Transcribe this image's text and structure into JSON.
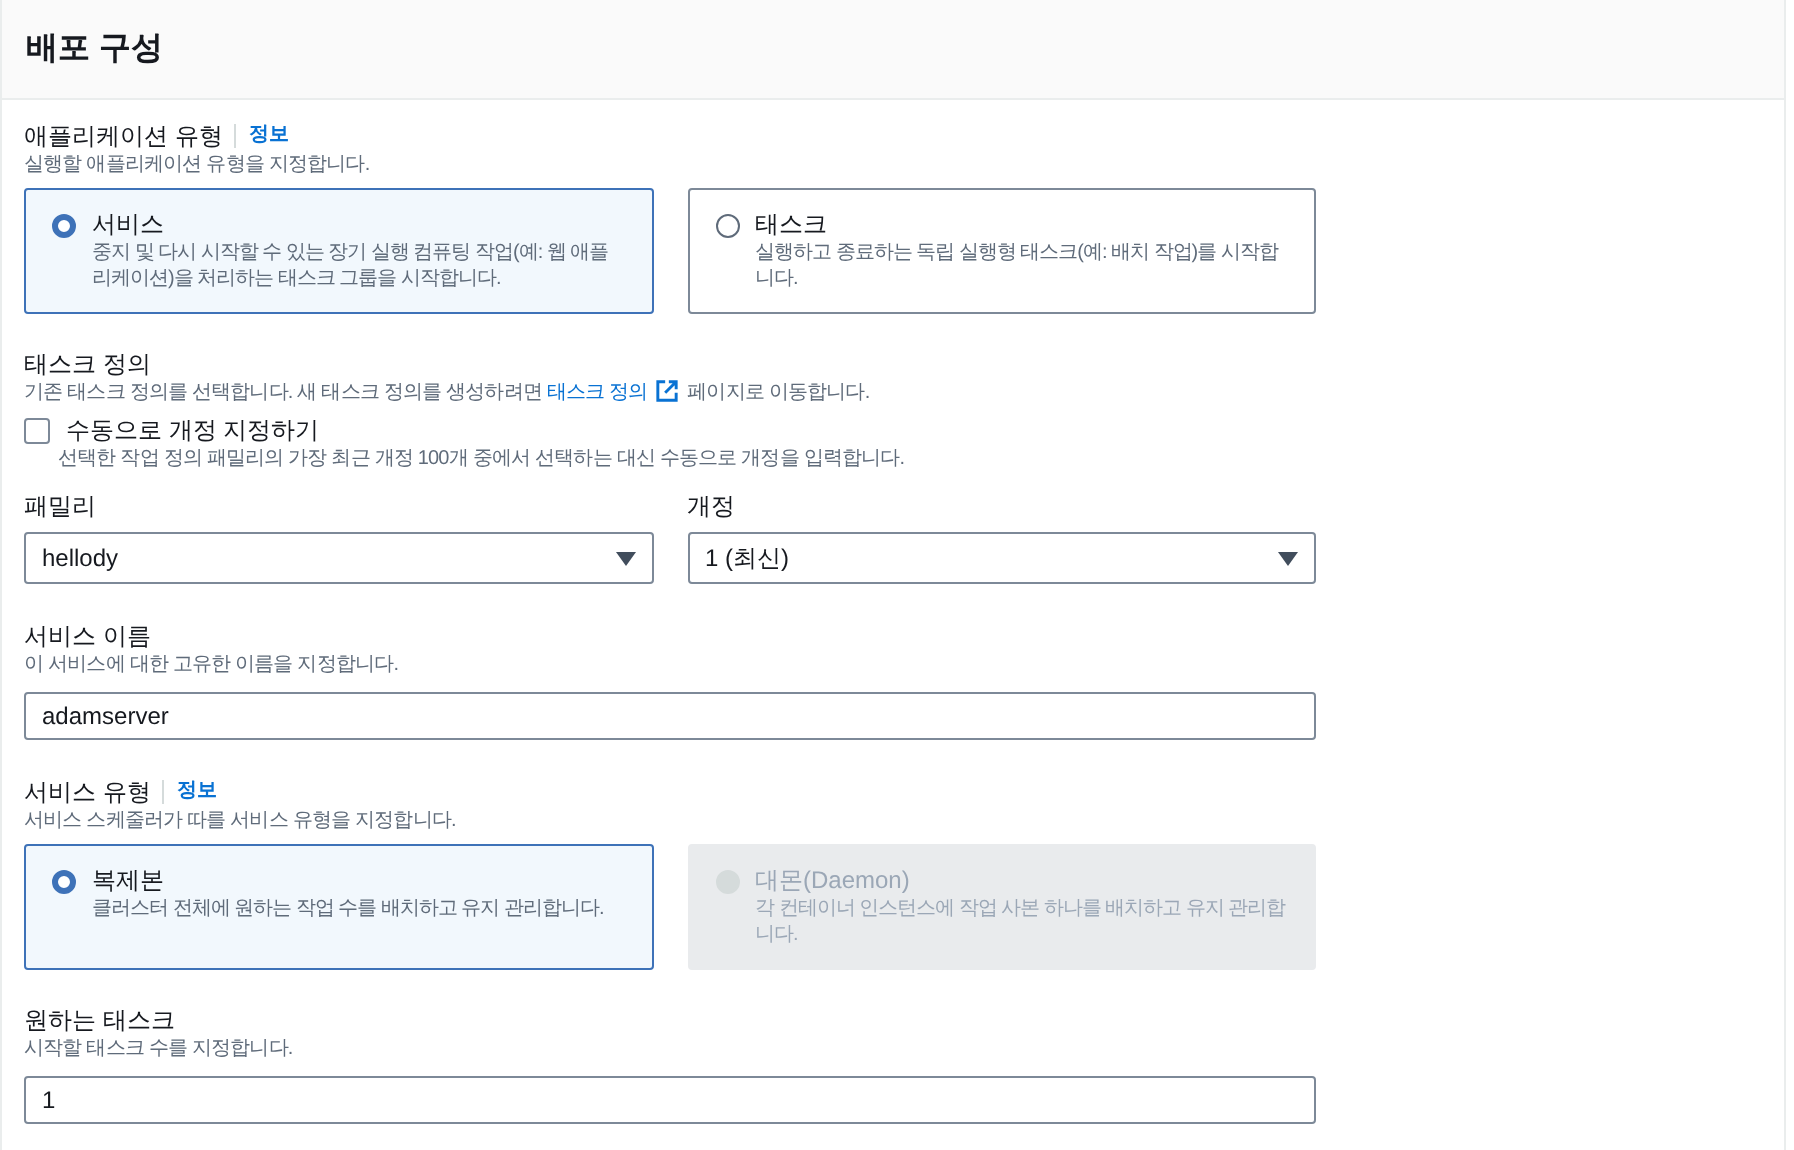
{
  "panel": {
    "title": "배포 구성"
  },
  "application_type": {
    "label": "애플리케이션 유형",
    "info": "정보",
    "description": "실행할 애플리케이션 유형을 지정합니다.",
    "options": [
      {
        "title": "서비스",
        "description": "중지 및 다시 시작할 수 있는 장기 실행 컴퓨팅 작업(예: 웹 애플리케이션)을 처리하는 태스크 그룹을 시작합니다.",
        "selected": true,
        "disabled": false
      },
      {
        "title": "태스크",
        "description": "실행하고 종료하는 독립 실행형 태스크(예: 배치 작업)를 시작합니다.",
        "selected": false,
        "disabled": false
      }
    ]
  },
  "task_definition": {
    "label": "태스크 정의",
    "description_before": "기존 태스크 정의를 선택합니다. 새 태스크 정의를 생성하려면",
    "link": "태스크 정의",
    "description_after": "페이지로 이동합니다.",
    "manual_revision": {
      "label": "수동으로 개정 지정하기",
      "description": "선택한 작업 정의 패밀리의 가장 최근 개정 100개 중에서 선택하는 대신 수동으로 개정을 입력합니다.",
      "checked": false
    },
    "family": {
      "label": "패밀리",
      "value": "hellody"
    },
    "revision": {
      "label": "개정",
      "value": "1 (최신)"
    }
  },
  "service_name": {
    "label": "서비스 이름",
    "description": "이 서비스에 대한 고유한 이름을 지정합니다.",
    "value": "adamserver"
  },
  "service_type": {
    "label": "서비스 유형",
    "info": "정보",
    "description": "서비스 스케줄러가 따를 서비스 유형을 지정합니다.",
    "options": [
      {
        "title": "복제본",
        "description": "클러스터 전체에 원하는 작업 수를 배치하고 유지 관리합니다.",
        "selected": true,
        "disabled": false
      },
      {
        "title": "대몬(Daemon)",
        "description": "각 컨테이너 인스턴스에 작업 사본 하나를 배치하고 유지 관리합니다.",
        "selected": false,
        "disabled": true
      }
    ]
  },
  "desired_tasks": {
    "label": "원하는 태스크",
    "description": "시작할 태스크 수를 지정합니다.",
    "value": "1"
  }
}
